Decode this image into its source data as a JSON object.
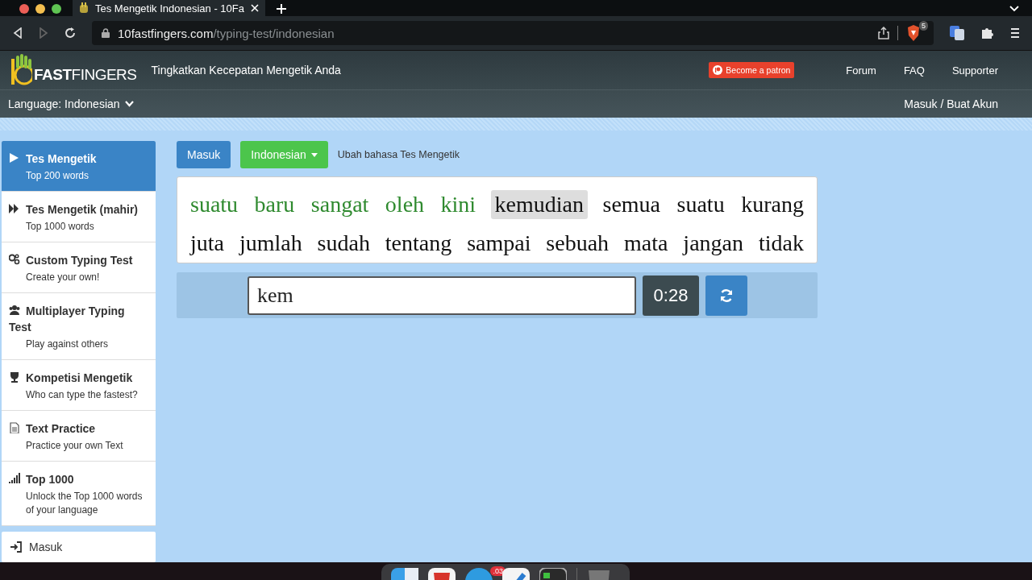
{
  "browser": {
    "tab": {
      "title": "Tes Mengetik Indonesian - 10Fa"
    },
    "url_host": "10fastfingers.com",
    "url_path": "/typing-test/indonesian",
    "shield_count": "5"
  },
  "header": {
    "logo": "**FAST**FINGERS",
    "tagline": "Tingkatkan Kecepatan Mengetik Anda",
    "patron": "Become a patron",
    "nav": [
      "Forum",
      "FAQ",
      "Supporter"
    ]
  },
  "subbar": {
    "language": "Language: Indonesian",
    "account": "Masuk / Buat Akun"
  },
  "sidebar": {
    "items": [
      {
        "title": "Tes Mengetik",
        "subtitle": "Top 200 words",
        "selected": true
      },
      {
        "title": "Tes Mengetik (mahir)",
        "subtitle": "Top 1000 words",
        "selected": false
      },
      {
        "title": "Custom Typing Test",
        "subtitle": "Create your own!",
        "selected": false
      },
      {
        "title": "Multiplayer Typing Test",
        "subtitle": "Play against others",
        "selected": false
      },
      {
        "title": "Kompetisi Mengetik",
        "subtitle": "Who can type the fastest?",
        "selected": false
      },
      {
        "title": "Text Practice",
        "subtitle": "Practice your own Text",
        "selected": false
      },
      {
        "title": "Top 1000",
        "subtitle": "Unlock the Top 1000 words of your language",
        "selected": false
      }
    ],
    "login": "Masuk"
  },
  "toolbar": {
    "login_button": "Masuk",
    "language_button": "Indonesian",
    "hint": "Ubah bahasa Tes Mengetik"
  },
  "words": {
    "lines": [
      [
        {
          "text": "suatu",
          "typed": true,
          "current": false
        },
        {
          "text": "baru",
          "typed": true,
          "current": false
        },
        {
          "text": "sangat",
          "typed": true,
          "current": false
        },
        {
          "text": "oleh",
          "typed": true,
          "current": false
        },
        {
          "text": "kini",
          "typed": true,
          "current": false
        },
        {
          "text": "kemudian",
          "typed": false,
          "current": true
        },
        {
          "text": "semua",
          "typed": false,
          "current": false
        },
        {
          "text": "suatu",
          "typed": false,
          "current": false
        },
        {
          "text": "kurang",
          "typed": false,
          "current": false
        }
      ],
      [
        {
          "text": "juta",
          "typed": false,
          "current": false
        },
        {
          "text": "jumlah",
          "typed": false,
          "current": false
        },
        {
          "text": "sudah",
          "typed": false,
          "current": false
        },
        {
          "text": "tentang",
          "typed": false,
          "current": false
        },
        {
          "text": "sampai",
          "typed": false,
          "current": false
        },
        {
          "text": "sebuah",
          "typed": false,
          "current": false
        },
        {
          "text": "mata",
          "typed": false,
          "current": false
        },
        {
          "text": "jangan",
          "typed": false,
          "current": false
        },
        {
          "text": "tidak",
          "typed": false,
          "current": false
        }
      ]
    ]
  },
  "input": {
    "value": "kem",
    "timer": "0:28"
  },
  "dock": {
    "badge": ".03"
  }
}
